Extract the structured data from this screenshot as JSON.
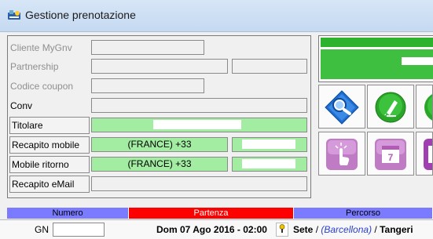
{
  "window": {
    "title": "Gestione prenotazione",
    "icon": "app-icon"
  },
  "form": {
    "cliente_label": "Cliente MyGnv",
    "partnership_label": "Partnership",
    "coupon_label": "Codice coupon",
    "conv_label": "Conv",
    "titolare_label": "Titolare",
    "recapito_mobile_label": "Recapito mobile",
    "recapito_mobile_prefix": "(FRANCE) +33",
    "mobile_ritorno_label": "Mobile ritorno",
    "mobile_ritorno_prefix": "(FRANCE) +33",
    "recapito_email_label": "Recapito eMail"
  },
  "buttons": [
    {
      "name": "search-button",
      "icon": "magnifier-icon",
      "color": "#1f6fd0"
    },
    {
      "name": "edit-button",
      "icon": "pencil-icon",
      "color": "#2aa52a"
    },
    {
      "name": "confirm-button",
      "icon": "green-icon",
      "color": "#2aa52a"
    },
    {
      "name": "touch-button",
      "icon": "hand-touch-icon",
      "color": "#c07bc5"
    },
    {
      "name": "calendar-button",
      "icon": "calendar-icon",
      "color": "#c07bc5",
      "calendar_day": "7"
    },
    {
      "name": "purple-button",
      "icon": "purple-icon",
      "color": "#a040b0"
    }
  ],
  "table": {
    "headers": [
      {
        "label": "Numero",
        "color": "#7b7bff"
      },
      {
        "label": "Partenza",
        "color": "#ff0000"
      },
      {
        "label": "Percorso",
        "color": "#7b7bff"
      }
    ],
    "row": {
      "numero_prefix": "GN",
      "partenza": "Dom 07 Ago 2016 - 02:00",
      "percorso_from": "Sete",
      "percorso_sep1": " / ",
      "percorso_via": "(Barcellona)",
      "percorso_sep2": " / ",
      "percorso_to": "Tangeri"
    }
  },
  "colors": {
    "green_field": "#a3eda3",
    "header_blue": "#7b7bff",
    "header_red": "#ff0000"
  }
}
